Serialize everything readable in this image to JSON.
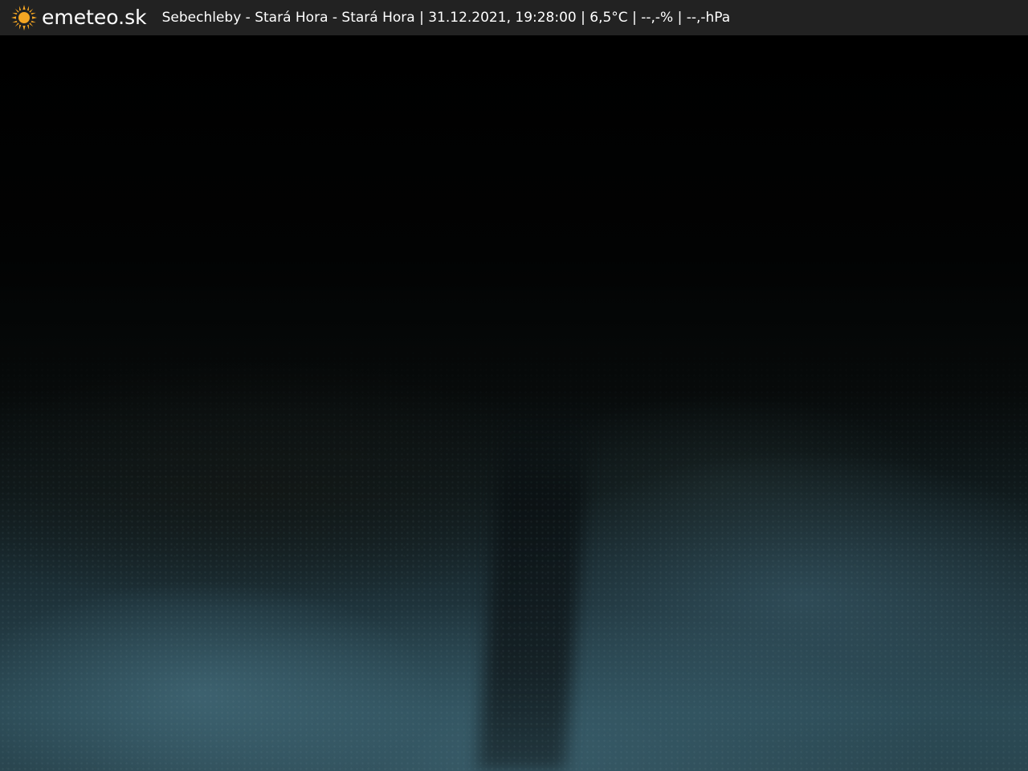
{
  "header": {
    "brand": "emeteo.sk",
    "logo_icon": "sun-icon",
    "caption": "Sebechleby - Stará Hora - Stará Hora | 31.12.2021, 19:28:00 | 6,5°C | --,-% | --,-hPa"
  },
  "colors": {
    "header_bg": "#222222",
    "header_text": "#ffffff",
    "sun": "#f5a623"
  }
}
